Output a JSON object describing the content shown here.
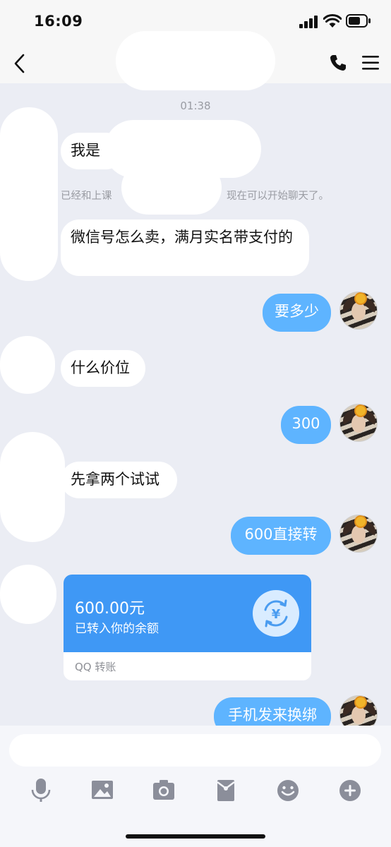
{
  "status_bar": {
    "time": "16:09"
  },
  "chat": {
    "timestamp": "01:38",
    "system_notice_left": "已经和上课",
    "system_notice_right": "现在可以开始聊天了。",
    "messages": [
      {
        "id": "m1",
        "direction": "in",
        "text": "我是"
      },
      {
        "id": "m2",
        "direction": "in",
        "text": "微信号怎么卖，满月实名带支付的"
      },
      {
        "id": "m3",
        "direction": "out",
        "text": "要多少"
      },
      {
        "id": "m4",
        "direction": "in",
        "text": "什么价位"
      },
      {
        "id": "m5",
        "direction": "out",
        "text": "300"
      },
      {
        "id": "m6",
        "direction": "in",
        "text": "先拿两个试试"
      },
      {
        "id": "m7",
        "direction": "out",
        "text": "600直接转"
      },
      {
        "id": "m9",
        "direction": "out",
        "text": "手机发来换绑"
      }
    ],
    "transfer": {
      "amount": "600.00元",
      "description": "已转入你的余额",
      "footer": "QQ 转账",
      "icon": "yuan-exchange-icon"
    }
  },
  "input": {
    "placeholder": ""
  },
  "toolbar": {
    "icons": [
      "microphone-icon",
      "image-icon",
      "camera-icon",
      "red-packet-icon",
      "emoji-icon",
      "plus-icon"
    ]
  },
  "colors": {
    "outgoing_bubble": "#5eb4ff",
    "transfer_card": "#3f98f5",
    "background": "#ebedf4"
  }
}
